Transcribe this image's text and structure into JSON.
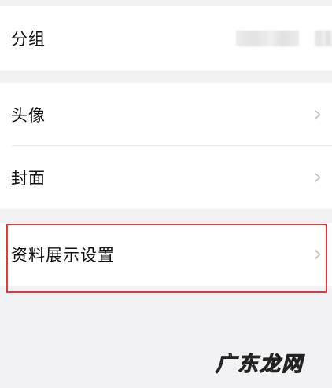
{
  "group_row": {
    "label": "分组"
  },
  "profile_rows": [
    {
      "label": "头像"
    },
    {
      "label": "封面"
    }
  ],
  "display_settings_row": {
    "label": "资料展示设置"
  },
  "icons": {
    "chevron": "chevron-right-icon"
  },
  "colors": {
    "background": "#f2f2f4",
    "card": "#ffffff",
    "highlight_border": "#e23a3a",
    "chevron": "#bfbfbf"
  },
  "watermark": {
    "text": "广东龙网"
  }
}
